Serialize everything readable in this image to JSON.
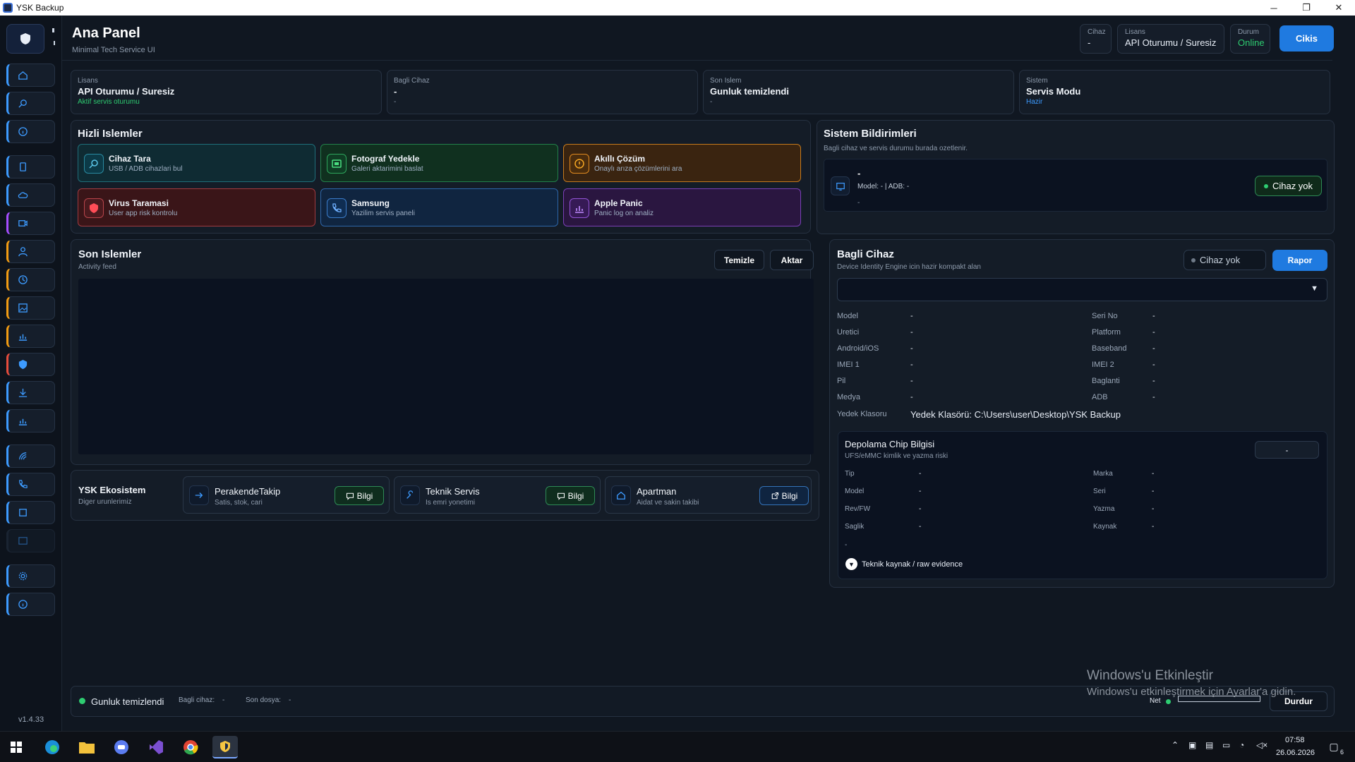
{
  "window": {
    "title": "YSK Backup",
    "min": "─",
    "max": "❐",
    "close": "✕"
  },
  "sidebar": {
    "version": "v1.4.33"
  },
  "header": {
    "title": "Ana Panel",
    "subtitle": "Minimal Tech Service UI",
    "cihaz": {
      "label": "Cihaz",
      "value": "-"
    },
    "lisans": {
      "label": "Lisans",
      "value": "API Oturumu / Suresiz"
    },
    "durum": {
      "label": "Durum",
      "value": "Online"
    },
    "exit_label": "Cikis"
  },
  "stats": [
    {
      "label": "Lisans",
      "value": "API Oturumu / Suresiz",
      "sub": "Aktif servis oturumu"
    },
    {
      "label": "Bagli Cihaz",
      "value": "-",
      "sub": "-"
    },
    {
      "label": "Son Islem",
      "value": "Gunluk temizlendi",
      "sub": "-"
    },
    {
      "label": "Sistem",
      "value": "Servis Modu",
      "sub": "Hazir"
    }
  ],
  "quick": {
    "title": "Hizli Islemler",
    "items": [
      {
        "title": "Cihaz Tara",
        "desc": "USB / ADB cihazlari bul"
      },
      {
        "title": "Fotograf Yedekle",
        "desc": "Galeri aktarimini baslat"
      },
      {
        "title": "Akıllı Çözüm",
        "desc": "Onaylı arıza çözümlerini ara"
      },
      {
        "title": "Virus Taramasi",
        "desc": "User app risk kontrolu"
      },
      {
        "title": "Samsung",
        "desc": "Yazilim servis paneli"
      },
      {
        "title": "Apple Panic",
        "desc": "Panic log on analiz"
      }
    ]
  },
  "recent": {
    "title": "Son Islemler",
    "subtitle": "Activity feed",
    "clear_label": "Temizle",
    "export_label": "Aktar"
  },
  "eco": {
    "title": "YSK Ekosistem",
    "subtitle": "Diger urunlerimiz",
    "items": [
      {
        "title": "PerakendeTakip",
        "desc": "Satis, stok, cari",
        "btn": "Bilgi"
      },
      {
        "title": "Teknik Servis",
        "desc": "Is emri yonetimi",
        "btn": "Bilgi"
      },
      {
        "title": "Apartman",
        "desc": "Aidat ve sakin takibi",
        "btn": "Bilgi"
      }
    ]
  },
  "notifications": {
    "title": "Sistem Bildirimleri",
    "subtitle": "Bagli cihaz ve servis durumu burada ozetlenir.",
    "device_name": "-",
    "device_meta": "Model: -  |  ADB: -",
    "device_extra": "-",
    "badge": "Cihaz yok"
  },
  "device": {
    "title": "Bagli Cihaz",
    "subtitle": "Device Identity Engine icin hazir kompakt alan",
    "status": "Cihaz yok",
    "report_label": "Rapor",
    "left": [
      {
        "k": "Model",
        "v": "-"
      },
      {
        "k": "Uretici",
        "v": "-"
      },
      {
        "k": "Android/iOS",
        "v": "-"
      },
      {
        "k": "IMEI 1",
        "v": "-"
      },
      {
        "k": "Pil",
        "v": "-"
      },
      {
        "k": "Medya",
        "v": "-"
      }
    ],
    "right": [
      {
        "k": "Seri No",
        "v": "-"
      },
      {
        "k": "Platform",
        "v": "-"
      },
      {
        "k": "Baseband",
        "v": "-"
      },
      {
        "k": "IMEI 2",
        "v": "-"
      },
      {
        "k": "Baglanti",
        "v": "-"
      },
      {
        "k": "ADB",
        "v": "-"
      }
    ],
    "backup_label": "Yedek Klasoru",
    "backup_value": "Yedek Klasörü: C:\\Users\\user\\Desktop\\YSK Backup"
  },
  "chip": {
    "title": "Depolama Chip Bilgisi",
    "subtitle": "UFS/eMMC kimlik ve yazma riski",
    "badge": "-",
    "left": [
      {
        "k": "Tip",
        "v": "-"
      },
      {
        "k": "Model",
        "v": "-"
      },
      {
        "k": "Rev/FW",
        "v": "-"
      },
      {
        "k": "Saglik",
        "v": "-"
      }
    ],
    "right": [
      {
        "k": "Marka",
        "v": "-"
      },
      {
        "k": "Seri",
        "v": "-"
      },
      {
        "k": "Yazma",
        "v": "-"
      },
      {
        "k": "Kaynak",
        "v": "-"
      }
    ],
    "extra": "-",
    "toggle_label": "Teknik kaynak / raw evidence"
  },
  "statusbar": {
    "status": "Gunluk temizlendi",
    "device_label": "Bagli cihaz:",
    "device_value": "-",
    "file_label": "Son dosya:",
    "file_value": "-",
    "net_label": "Net",
    "stop_label": "Durdur"
  },
  "watermark": {
    "line1": "Windows'u Etkinleştir",
    "line2": "Windows'u etkinleştirmek için Ayarlar'a gidin."
  },
  "taskbar": {
    "time": "07:58",
    "date": "26.06.2026",
    "notif_count": "6"
  },
  "colors": {
    "accent": "#1f7ae0",
    "online": "#2ecc71",
    "panel": "#141c27"
  }
}
